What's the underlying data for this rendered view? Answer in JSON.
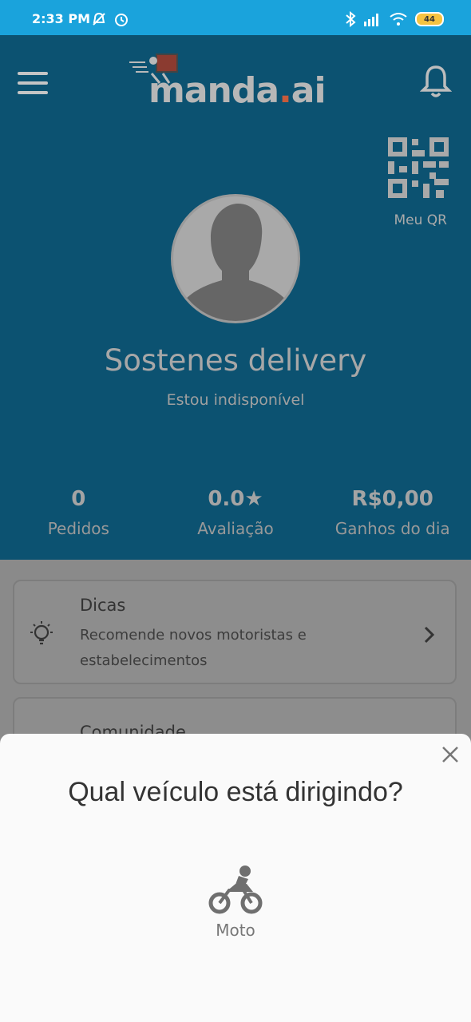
{
  "status_bar": {
    "time": "2:33 PM",
    "battery": "44"
  },
  "header": {
    "logo_text_main": "manda",
    "logo_text_dot": ".",
    "logo_text_end": "ai",
    "qr_label": "Meu QR"
  },
  "profile": {
    "name": "Sostenes delivery",
    "status": "Estou indisponível"
  },
  "stats": [
    {
      "value": "0",
      "label": "Pedidos"
    },
    {
      "value": "0.0★",
      "label": "Avaliação"
    },
    {
      "value": "R$0,00",
      "label": "Ganhos do dia"
    }
  ],
  "cards": {
    "dicas": {
      "title": "Dicas",
      "description": "Recomende novos motoristas e estabelecimentos"
    },
    "comunidade": {
      "title": "Comunidade"
    }
  },
  "sheet": {
    "title": "Qual veículo está dirigindo?",
    "options": [
      {
        "label": "Moto",
        "icon": "motorcycle-icon"
      }
    ]
  },
  "colors": {
    "status_bar": "#1aa3dc",
    "header_bg": "#0c5271",
    "logo_accent": "#c75a3a",
    "sheet_bg": "#fafafa"
  }
}
